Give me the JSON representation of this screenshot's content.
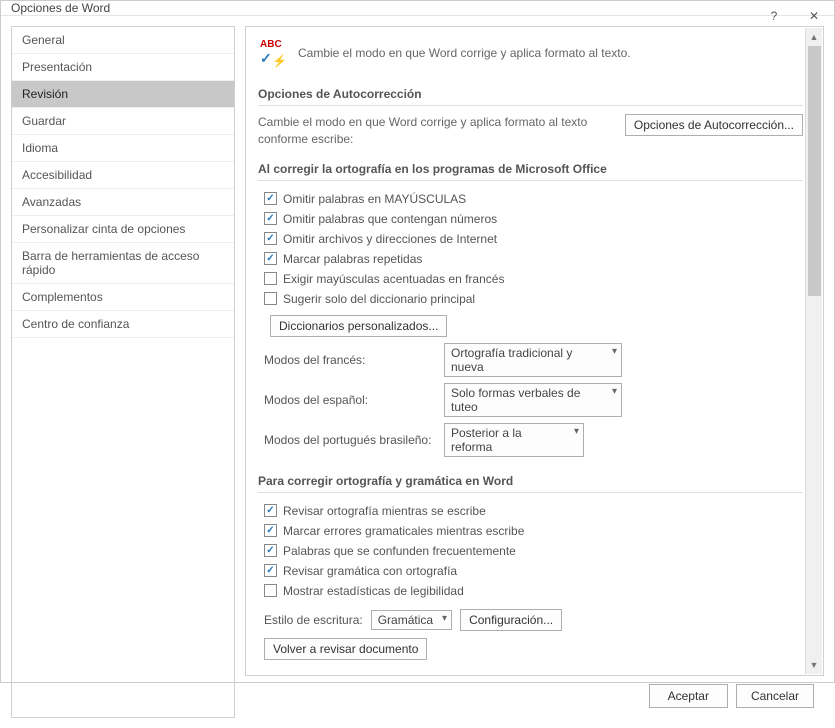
{
  "window_title": "Opciones de Word",
  "sidebar": {
    "items": [
      {
        "label": "General"
      },
      {
        "label": "Presentación"
      },
      {
        "label": "Revisión"
      },
      {
        "label": "Guardar"
      },
      {
        "label": "Idioma"
      },
      {
        "label": "Accesibilidad"
      },
      {
        "label": "Avanzadas"
      },
      {
        "label": "Personalizar cinta de opciones"
      },
      {
        "label": "Barra de herramientas de acceso rápido"
      },
      {
        "label": "Complementos"
      },
      {
        "label": "Centro de confianza"
      }
    ],
    "selected_index": 2
  },
  "header": {
    "text": "Cambie el modo en que Word corrige y aplica formato al texto."
  },
  "sections": {
    "autocorrect": {
      "title": "Opciones de Autocorrección",
      "text": "Cambie el modo en que Word corrige y aplica formato al texto conforme escribe:",
      "button": "Opciones de Autocorrección..."
    },
    "spelling_office": {
      "title": "Al corregir la ortografía en los programas de Microsoft Office",
      "c1": "Omitir palabras en MAYÚSCULAS",
      "c2": "Omitir palabras que contengan números",
      "c3": "Omitir archivos y direcciones de Internet",
      "c4": "Marcar palabras repetidas",
      "c5": "Exigir mayúsculas acentuadas en francés",
      "c6": "Sugerir solo del diccionario principal",
      "dict_button": "Diccionarios personalizados...",
      "french_label": "Modos del francés:",
      "french_value": "Ortografía tradicional y nueva",
      "spanish_label": "Modos del español:",
      "spanish_value": "Solo formas verbales de tuteo",
      "portuguese_label": "Modos del portugués brasileño:",
      "portuguese_value": "Posterior a la reforma"
    },
    "spelling_word": {
      "title": "Para corregir ortografía y gramática en Word",
      "c1": "Revisar ortografía mientras se escribe",
      "c2": "Marcar errores gramaticales mientras escribe",
      "c3": "Palabras que se confunden frecuentemente",
      "c4": "Revisar gramática con ortografía",
      "c5": "Mostrar estadísticas de legibilidad",
      "style_label": "Estilo de escritura:",
      "style_value": "Gramática",
      "config_button": "Configuración...",
      "recheck_button": "Volver a revisar documento"
    }
  },
  "footer": {
    "ok": "Aceptar",
    "cancel": "Cancelar"
  }
}
